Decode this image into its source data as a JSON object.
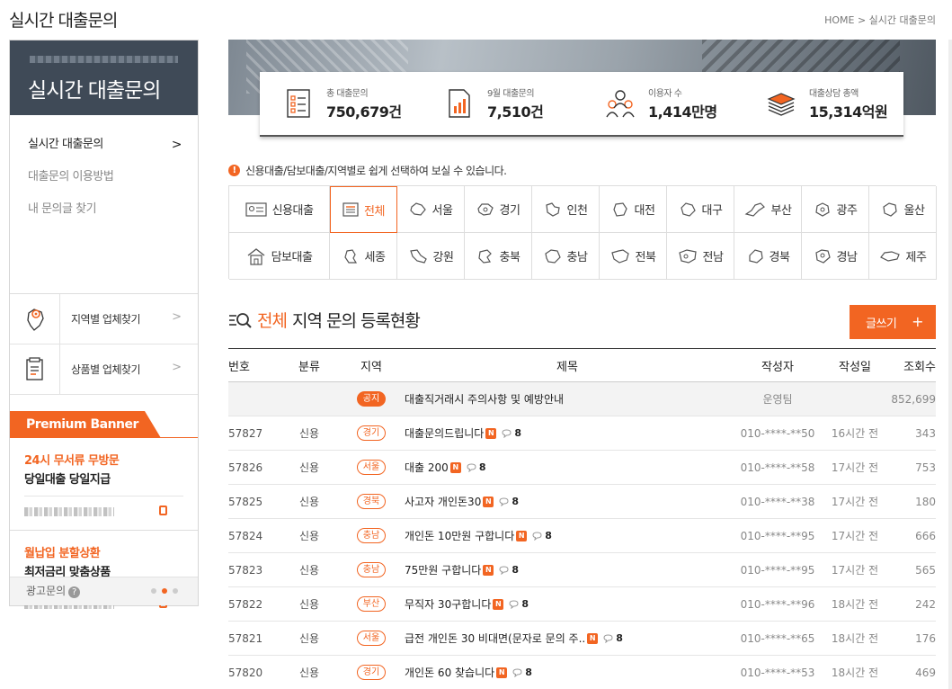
{
  "page": {
    "title": "실시간 대출문의"
  },
  "breadcrumb": {
    "home": "HOME",
    "sep": ">",
    "current": "실시간 대출문의"
  },
  "sidebar": {
    "heading": "실시간 대출문의",
    "menu": [
      {
        "label": "실시간 대출문의",
        "active": true,
        "arrow": ">"
      },
      {
        "label": "대출문의 이용방법",
        "active": false
      },
      {
        "label": "내 문의글 찾기",
        "active": false
      }
    ],
    "links": [
      {
        "label": "지역별 업체찾기",
        "icon": "map-pin-icon",
        "arrow": ">"
      },
      {
        "label": "상품별 업체찾기",
        "icon": "document-list-icon",
        "arrow": ">"
      }
    ],
    "premium": {
      "label": "Premium Banner",
      "banners": [
        {
          "line1": "24시 무서류 무방문",
          "line2": "당일대출 당일지급"
        },
        {
          "line1": "월납입 분할상환",
          "line2": "최저금리 맞춤상품"
        }
      ]
    },
    "ad": {
      "label": "광고문의",
      "help": "?"
    }
  },
  "stats": [
    {
      "label": "총 대출문의",
      "value": "750,679건",
      "icon": "checklist-icon"
    },
    {
      "label": "9월 대출문의",
      "value": "7,510건",
      "icon": "bar-doc-icon"
    },
    {
      "label": "이용자 수",
      "value": "1,414만명",
      "icon": "users-icon"
    },
    {
      "label": "대출상담 총액",
      "value": "15,314억원",
      "icon": "money-stack-icon"
    }
  ],
  "notice": {
    "text": "신용대출/담보대출/지역별로 쉽게 선택하여 보실 수 있습니다.",
    "bang": "!"
  },
  "filters": {
    "credit_label": "신용대출",
    "collateral_label": "담보대출",
    "row1": [
      "전체",
      "서울",
      "경기",
      "인천",
      "대전",
      "대구",
      "부산",
      "광주",
      "울산"
    ],
    "row2": [
      "세종",
      "강원",
      "충북",
      "충남",
      "전북",
      "전남",
      "경북",
      "경남",
      "제주"
    ],
    "active": "전체"
  },
  "section": {
    "highlight": "전체",
    "rest": "지역 문의 등록현황",
    "write_label": "글쓰기",
    "write_plus": "+"
  },
  "table": {
    "headers": {
      "no": "번호",
      "cat": "분류",
      "region": "지역",
      "title": "제목",
      "writer": "작성자",
      "date": "작성일",
      "views": "조회수"
    },
    "notice_row": {
      "badge": "공지",
      "title": "대출직거래시 주의사항 및 예방안내",
      "writer": "운영팀",
      "views": "852,699"
    },
    "rows": [
      {
        "no": "57827",
        "cat": "신용",
        "region": "경기",
        "title": "대출문의드립니다",
        "comments": "8",
        "writer": "010-****-**50",
        "date": "16시간 전",
        "views": "343"
      },
      {
        "no": "57826",
        "cat": "신용",
        "region": "서울",
        "title": "대출 200",
        "comments": "8",
        "writer": "010-****-**58",
        "date": "17시간 전",
        "views": "753"
      },
      {
        "no": "57825",
        "cat": "신용",
        "region": "경북",
        "title": "사고자 개인돈30",
        "comments": "8",
        "writer": "010-****-**38",
        "date": "17시간 전",
        "views": "180"
      },
      {
        "no": "57824",
        "cat": "신용",
        "region": "충남",
        "title": "개인돈 10만원 구합니다",
        "comments": "8",
        "writer": "010-****-**95",
        "date": "17시간 전",
        "views": "666"
      },
      {
        "no": "57823",
        "cat": "신용",
        "region": "충남",
        "title": "75만원 구합니다",
        "comments": "8",
        "writer": "010-****-**95",
        "date": "17시간 전",
        "views": "565"
      },
      {
        "no": "57822",
        "cat": "신용",
        "region": "부산",
        "title": "무직자 30구합니다",
        "comments": "8",
        "writer": "010-****-**96",
        "date": "18시간 전",
        "views": "242"
      },
      {
        "no": "57821",
        "cat": "신용",
        "region": "서울",
        "title": "급전 개인돈 30 비대면(문자로 문의 주..",
        "comments": "8",
        "writer": "010-****-**65",
        "date": "18시간 전",
        "views": "176"
      },
      {
        "no": "57820",
        "cat": "신용",
        "region": "경기",
        "title": "개인돈 60 찾습니다",
        "comments": "8",
        "writer": "010-****-**53",
        "date": "18시간 전",
        "views": "469"
      }
    ],
    "new_badge": "N"
  },
  "colors": {
    "accent": "#f26522",
    "sidebar_head": "#3f4a57"
  }
}
